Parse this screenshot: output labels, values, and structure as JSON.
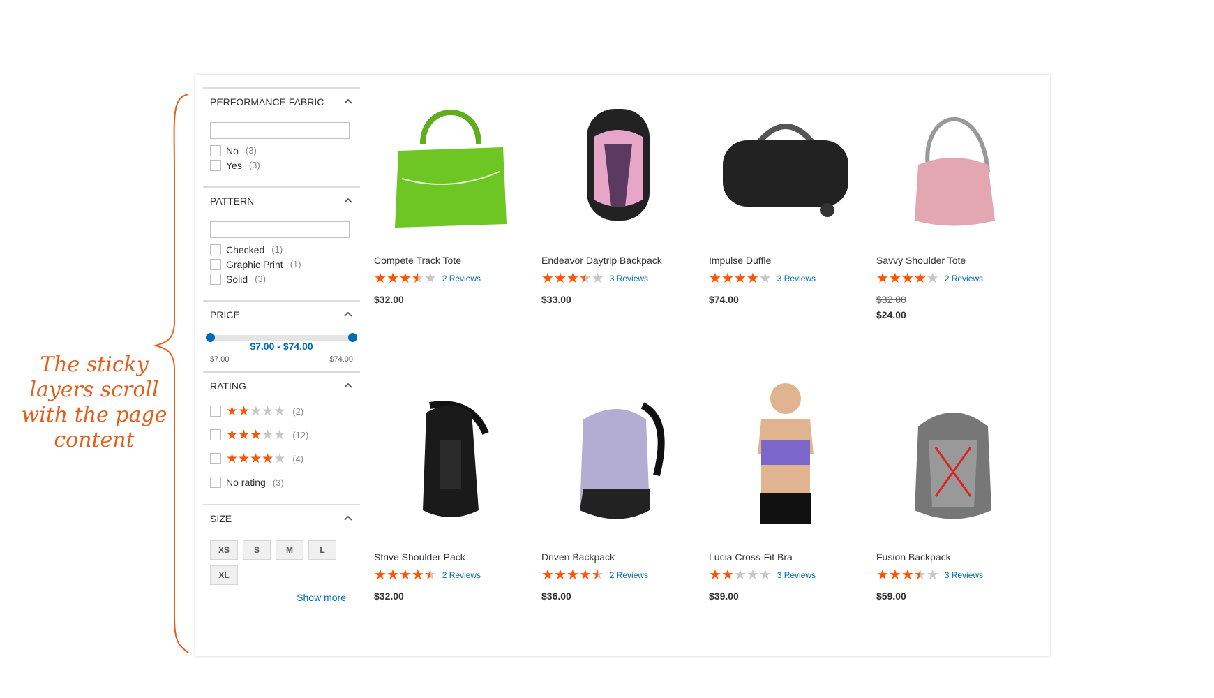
{
  "annotation": {
    "text": "The sticky layers scroll with the page content",
    "color": "#e2601b"
  },
  "filters": {
    "performance_fabric": {
      "title": "PERFORMANCE FABRIC",
      "options": [
        {
          "label": "No",
          "count": "(3)"
        },
        {
          "label": "Yes",
          "count": "(3)"
        }
      ]
    },
    "pattern": {
      "title": "PATTERN",
      "options": [
        {
          "label": "Checked",
          "count": "(1)"
        },
        {
          "label": "Graphic Print",
          "count": "(1)"
        },
        {
          "label": "Solid",
          "count": "(3)"
        }
      ]
    },
    "price": {
      "title": "PRICE",
      "range": "$7.00 - $74.00",
      "min": "$7.00",
      "max": "$74.00"
    },
    "rating": {
      "title": "RATING",
      "options": [
        {
          "stars": 2,
          "count": "(2)"
        },
        {
          "stars": 3,
          "count": "(12)"
        },
        {
          "stars": 4,
          "count": "(4)"
        }
      ],
      "no_rating": {
        "label": "No rating",
        "count": "(3)"
      }
    },
    "size": {
      "title": "SIZE",
      "options": [
        "XS",
        "S",
        "M",
        "L",
        "XL"
      ],
      "show_more": "Show more"
    }
  },
  "products": [
    {
      "name": "Compete Track Tote",
      "rating": 3.5,
      "reviews": "2 Reviews",
      "price": "$32.00",
      "image": "green-tote-bag"
    },
    {
      "name": "Endeavor Daytrip Backpack",
      "rating": 3.5,
      "reviews": "3 Reviews",
      "price": "$33.00",
      "image": "pink-black-backpack"
    },
    {
      "name": "Impulse Duffle",
      "rating": 4,
      "reviews": "3 Reviews",
      "price": "$74.00",
      "image": "black-duffle-bag"
    },
    {
      "name": "Savvy Shoulder Tote",
      "rating": 4,
      "reviews": "2 Reviews",
      "old_price": "$32.00",
      "price": "$24.00",
      "image": "pink-shoulder-bag"
    },
    {
      "name": "Strive Shoulder Pack",
      "rating": 4.5,
      "reviews": "2 Reviews",
      "price": "$32.00",
      "image": "black-sling-pack"
    },
    {
      "name": "Driven Backpack",
      "rating": 4.5,
      "reviews": "2 Reviews",
      "price": "$36.00",
      "image": "lavender-backpack"
    },
    {
      "name": "Lucia Cross-Fit Bra",
      "rating": 2,
      "reviews": "3 Reviews",
      "price": "$39.00",
      "image": "woman-sports-bra"
    },
    {
      "name": "Fusion Backpack",
      "rating": 3.5,
      "reviews": "3 Reviews",
      "price": "$59.00",
      "image": "gray-red-backpack"
    }
  ],
  "colors": {
    "accent": "#006bb4",
    "star": "#ff5501",
    "star_off": "#c7c7c7"
  }
}
